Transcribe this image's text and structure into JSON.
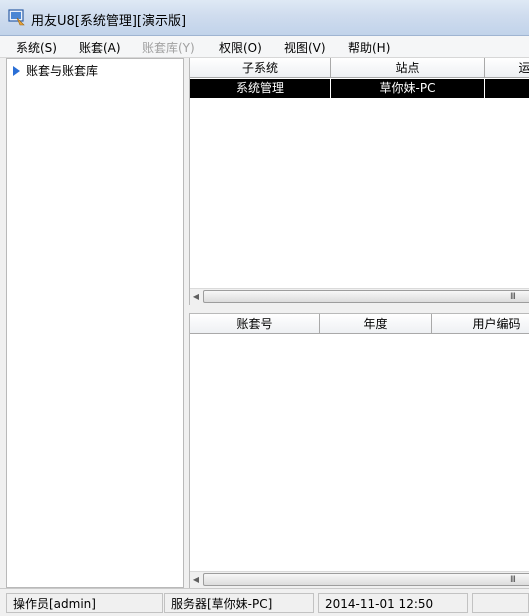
{
  "window": {
    "title": "用友U8[系统管理][演示版]"
  },
  "menu": {
    "items": [
      {
        "label": "系统(S)",
        "enabled": true
      },
      {
        "label": "账套(A)",
        "enabled": true
      },
      {
        "label": "账套库(Y)",
        "enabled": false
      },
      {
        "label": "权限(O)",
        "enabled": true
      },
      {
        "label": "视图(V)",
        "enabled": true
      },
      {
        "label": "帮助(H)",
        "enabled": true
      }
    ]
  },
  "tree": {
    "root_label": "账套与账套库"
  },
  "top_table": {
    "columns": [
      "子系统",
      "站点",
      "运"
    ],
    "rows": [
      [
        "系统管理",
        "草你妹-PC",
        ""
      ]
    ]
  },
  "bottom_table": {
    "columns": [
      "账套号",
      "年度",
      "用户编码"
    ],
    "rows": []
  },
  "scrollbar": {
    "grip": "III"
  },
  "status": {
    "operator": "操作员[admin]",
    "server": "服务器[草你妹-PC]",
    "datetime": "2014-11-01 12:50"
  },
  "colors": {
    "selection_bg": "#000000",
    "selection_text": "#ffffff",
    "tree_arrow": "#2a6fd6"
  },
  "icons": {
    "app": "u8-app-icon",
    "tree_expand": "triangle-right-icon",
    "scroll_left": "arrow-left-icon"
  }
}
